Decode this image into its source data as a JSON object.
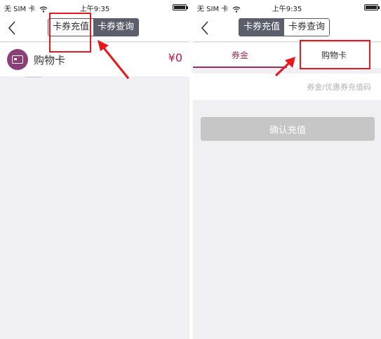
{
  "left_screen": {
    "status_bar": {
      "carrier": "无 SIM 卡",
      "time": "上午9:35",
      "battery_level": 0.9
    },
    "nav": {
      "segments": [
        "卡券充值",
        "卡券查询"
      ],
      "active_segment": 1
    },
    "card_row": {
      "label": "购物卡",
      "amount": "¥0"
    }
  },
  "right_screen": {
    "status_bar": {
      "carrier": "无 SIM 卡",
      "time": "上午9:35",
      "battery_level": 0.9
    },
    "nav": {
      "segments": [
        "卡券充值",
        "卡券查询"
      ],
      "active_segment": 0
    },
    "tabs": [
      "券金",
      "购物卡"
    ],
    "active_tab": 0,
    "code_input": {
      "value": "",
      "placeholder": "券金/优惠券充值码"
    },
    "confirm_button": "确认充值"
  },
  "colors": {
    "accent": "#a02c5a",
    "amount": "#c8144a",
    "card_icon": "#8c3e78",
    "highlight": "#e8171d",
    "segment_active": "#5b5f6b",
    "button_disabled": "#c6c6c6"
  },
  "icons": [
    "wifi-icon",
    "battery-icon",
    "back-chevron-icon",
    "card-icon"
  ]
}
